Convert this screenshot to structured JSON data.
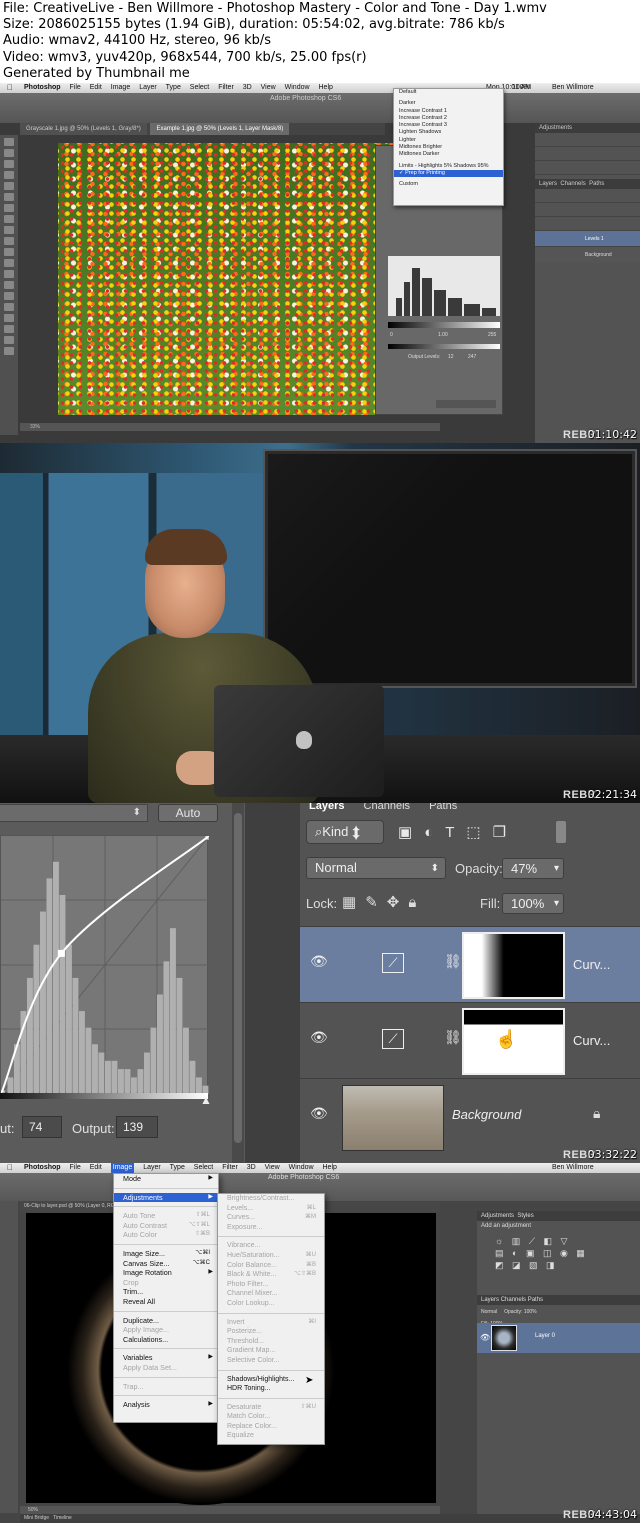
{
  "header": {
    "lines": [
      "File: CreativeLive - Ben Willmore - Photoshop Mastery - Color and Tone - Day 1.wmv",
      "Size: 2086025155 bytes (1.94 GiB), duration: 05:54:02, avg.bitrate: 786 kb/s",
      "Audio: wmav2, 44100 Hz, stereo, 96 kb/s",
      "Video: wmv3, yuv420p, 968x544, 700 kb/s, 25.00 fps(r)",
      "Generated by Thumbnail me"
    ]
  },
  "frames": [
    {
      "timestamp": "01:10:42",
      "watermark": "REBR",
      "menubar": [
        "Photoshop",
        "File",
        "Edit",
        "Image",
        "Layer",
        "Type",
        "Select",
        "Filter",
        "3D",
        "View",
        "Window",
        "Help"
      ],
      "clock": "Mon 10:01 AM",
      "battery": "100%",
      "user": "Ben Willmore",
      "window_title": "Adobe Photoshop CS6",
      "doc_tabs": [
        "Grayscale 1.jpg @ 50% (Levels 1, Gray/8*)",
        "Example 1.jpg @ 50% (Levels 1, Layer Mask/8)"
      ],
      "preset_menu": {
        "items": [
          "Default",
          "",
          "Darker",
          "Increase Contrast 1",
          "Increase Contrast 2",
          "Increase Contrast 3",
          "Lighten Shadows",
          "Lighter",
          "Midtones Brighter",
          "Midtones Darker",
          "",
          "Limits - Highlights 5% Shadows 95%",
          "Prep for Printing",
          "",
          "Custom"
        ],
        "selected": "Prep for Printing"
      },
      "panels": {
        "adjustments": "Adjustments",
        "layers_tabs": [
          "Layers",
          "Channels",
          "Paths"
        ],
        "layers": [
          "Levels 1",
          "Background"
        ]
      },
      "dialog": {
        "levels_in": [
          "0",
          "1.00",
          "255"
        ],
        "output_label": "Output Levels:",
        "output": [
          "12",
          "247"
        ]
      },
      "status": "33%"
    },
    {
      "timestamp": "02:21:34",
      "watermark": "REBR"
    },
    {
      "timestamp": "03:32:22",
      "watermark": "REBR",
      "auto_label": "Auto",
      "input_label": "ut:",
      "input_value": "74",
      "output_label": "Output:",
      "output_value": "139",
      "layers_panel": {
        "tabs": [
          "Layers",
          "Channels",
          "Paths"
        ],
        "kind_label": "Kind",
        "blend_mode": "Normal",
        "opacity_label": "Opacity:",
        "opacity": "47%",
        "lock_label": "Lock:",
        "fill_label": "Fill:",
        "fill": "100%",
        "layers": [
          {
            "name": "Curv...",
            "selected": true
          },
          {
            "name": "Curv...",
            "selected": false
          },
          {
            "name": "Background",
            "selected": false,
            "locked": true
          }
        ]
      },
      "curve_points": [
        {
          "input": 0,
          "output": 0
        },
        {
          "input": 74,
          "output": 139
        },
        {
          "input": 255,
          "output": 255
        }
      ]
    },
    {
      "timestamp": "04:43:04",
      "watermark": "REBR",
      "menubar": [
        "Photoshop",
        "File",
        "Edit",
        "Image",
        "Layer",
        "Type",
        "Select",
        "Filter",
        "3D",
        "View",
        "Window",
        "Help"
      ],
      "user": "Ben Willmore",
      "window_title": "Adobe Photoshop CS6",
      "doc_tab": "06-Clip to layer.psd @ 50% (Layer 0, RGB/8)",
      "image_menu": [
        {
          "label": "Mode",
          "arrow": true
        },
        {
          "sep": true
        },
        {
          "label": "Adjustments",
          "arrow": true,
          "selected": true
        },
        {
          "sep": true
        },
        {
          "label": "Auto Tone",
          "shortcut": "⇧⌘L",
          "disabled": true
        },
        {
          "label": "Auto Contrast",
          "shortcut": "⌥⇧⌘L",
          "disabled": true
        },
        {
          "label": "Auto Color",
          "shortcut": "⇧⌘B",
          "disabled": true
        },
        {
          "sep": true
        },
        {
          "label": "Image Size...",
          "shortcut": "⌥⌘I"
        },
        {
          "label": "Canvas Size...",
          "shortcut": "⌥⌘C"
        },
        {
          "label": "Image Rotation",
          "arrow": true
        },
        {
          "label": "Crop",
          "disabled": true
        },
        {
          "label": "Trim..."
        },
        {
          "label": "Reveal All"
        },
        {
          "sep": true
        },
        {
          "label": "Duplicate..."
        },
        {
          "label": "Apply Image...",
          "disabled": true
        },
        {
          "label": "Calculations..."
        },
        {
          "sep": true
        },
        {
          "label": "Variables",
          "arrow": true
        },
        {
          "label": "Apply Data Set...",
          "disabled": true
        },
        {
          "sep": true
        },
        {
          "label": "Trap...",
          "disabled": true
        },
        {
          "sep": true
        },
        {
          "label": "Analysis",
          "arrow": true
        }
      ],
      "adjust_menu": [
        {
          "label": "Brightness/Contrast...",
          "disabled": true
        },
        {
          "label": "Levels...",
          "shortcut": "⌘L",
          "disabled": true
        },
        {
          "label": "Curves...",
          "shortcut": "⌘M",
          "disabled": true
        },
        {
          "label": "Exposure...",
          "disabled": true
        },
        {
          "sep": true
        },
        {
          "label": "Vibrance...",
          "disabled": true
        },
        {
          "label": "Hue/Saturation...",
          "shortcut": "⌘U",
          "disabled": true
        },
        {
          "label": "Color Balance...",
          "shortcut": "⌘B",
          "disabled": true
        },
        {
          "label": "Black & White...",
          "shortcut": "⌥⇧⌘B",
          "disabled": true
        },
        {
          "label": "Photo Filter...",
          "disabled": true
        },
        {
          "label": "Channel Mixer...",
          "disabled": true
        },
        {
          "label": "Color Lookup...",
          "disabled": true
        },
        {
          "sep": true
        },
        {
          "label": "Invert",
          "shortcut": "⌘I",
          "disabled": true
        },
        {
          "label": "Posterize...",
          "disabled": true
        },
        {
          "label": "Threshold...",
          "disabled": true
        },
        {
          "label": "Gradient Map...",
          "disabled": true
        },
        {
          "label": "Selective Color...",
          "disabled": true
        },
        {
          "sep": true
        },
        {
          "label": "Shadows/Highlights..."
        },
        {
          "label": "HDR Toning..."
        },
        {
          "sep": true
        },
        {
          "label": "Desaturate",
          "shortcut": "⇧⌘U",
          "disabled": true
        },
        {
          "label": "Match Color...",
          "disabled": true
        },
        {
          "label": "Replace Color...",
          "disabled": true
        },
        {
          "label": "Equalize",
          "disabled": true
        }
      ],
      "panels": {
        "adjustments": "Adjustments",
        "styles": "Styles",
        "add_adjustment": "Add an adjustment",
        "layers_tabs": [
          "Layers",
          "Channels",
          "Paths"
        ],
        "layer": "Layer 0",
        "blend": "Normal",
        "opacity": "100%",
        "fill": "100%"
      },
      "status": "50%",
      "bottom_tabs": [
        "Mini Bridge",
        "Timeline"
      ]
    }
  ]
}
